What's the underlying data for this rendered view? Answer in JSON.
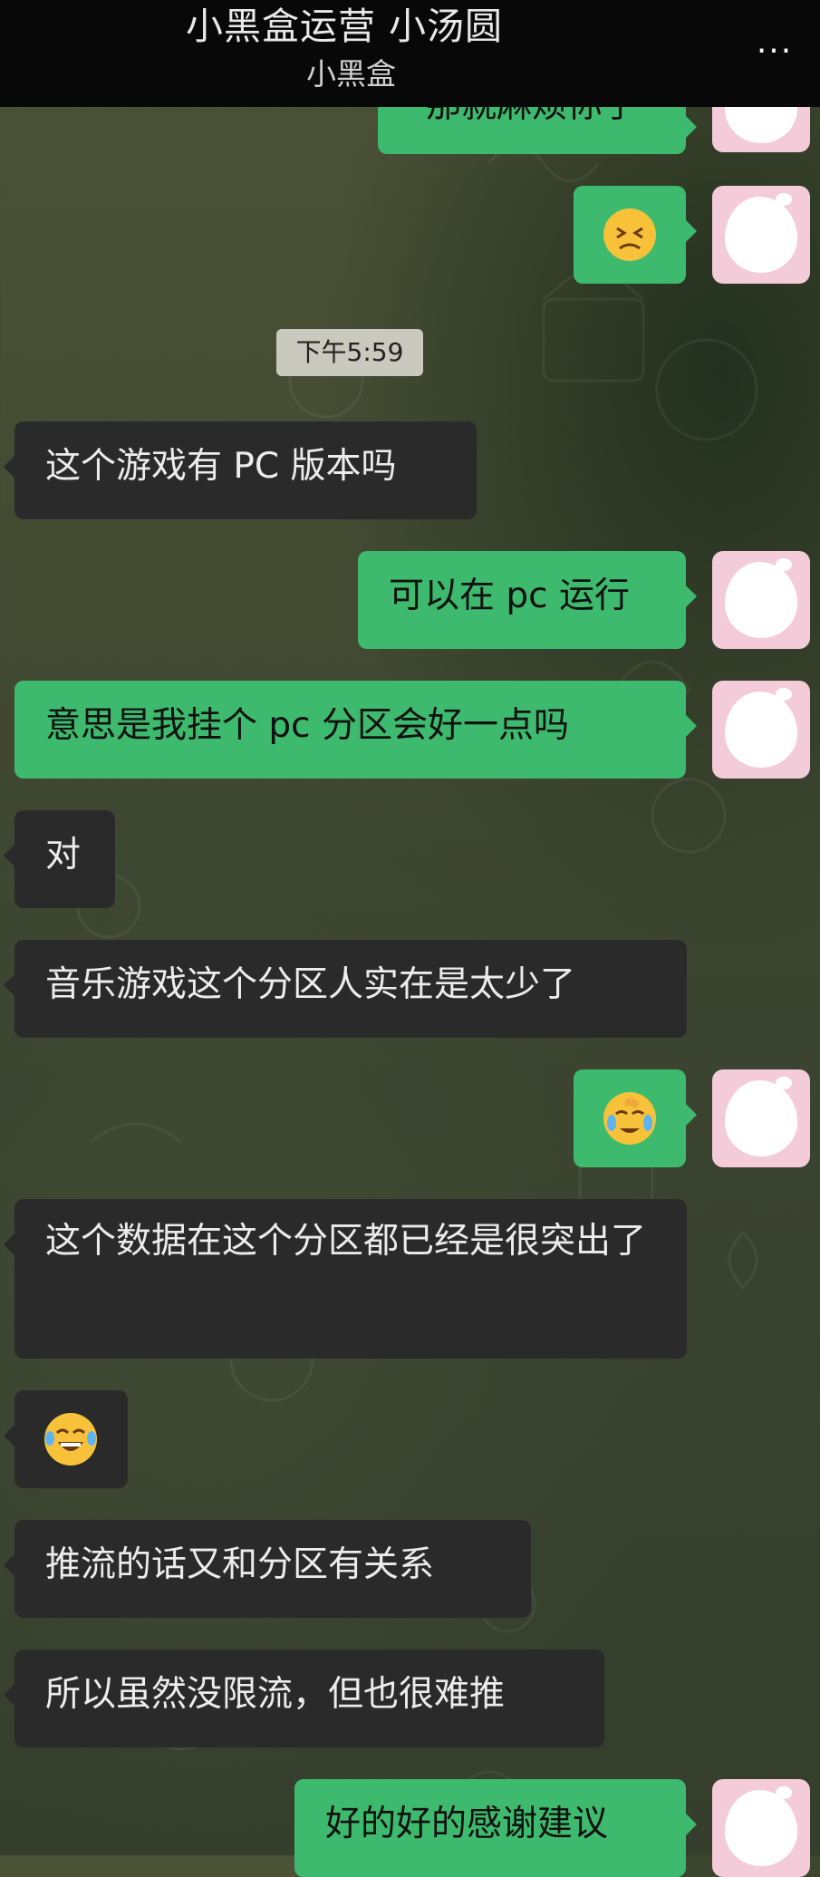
{
  "header": {
    "title": "小黑盒运营 小汤圆",
    "subtitle": "小黑盒",
    "more_label": "···"
  },
  "timestamp": "下午5:59",
  "messages": [
    {
      "side": "out",
      "text": "那就麻烦你了",
      "partial": true
    },
    {
      "side": "out",
      "emoji": "persevering-face-emoji"
    },
    {
      "side": "in",
      "text": "这个游戏有 PC 版本吗"
    },
    {
      "side": "out",
      "text": "可以在 pc 运行"
    },
    {
      "side": "out",
      "text": "意思是我挂个 pc 分区会好一点吗"
    },
    {
      "side": "in",
      "text": "对"
    },
    {
      "side": "in",
      "text": "音乐游戏这个分区人实在是太少了"
    },
    {
      "side": "out",
      "emoji": "face-palm-tears-emoji"
    },
    {
      "side": "in",
      "text": "这个数据在这个分区都已经是很突出了"
    },
    {
      "side": "in",
      "emoji": "tears-of-joy-emoji"
    },
    {
      "side": "in",
      "text": "推流的话又和分区有关系"
    },
    {
      "side": "in",
      "text": "所以虽然没限流，但也很难推"
    },
    {
      "side": "out",
      "text": "好的好的感谢建议",
      "partial": true
    }
  ],
  "colors": {
    "outgoing_bubble": "#3dba6d",
    "incoming_bubble": "#2a2a2a",
    "avatar_bg": "#f4ccd9",
    "topbar": "#080808"
  }
}
